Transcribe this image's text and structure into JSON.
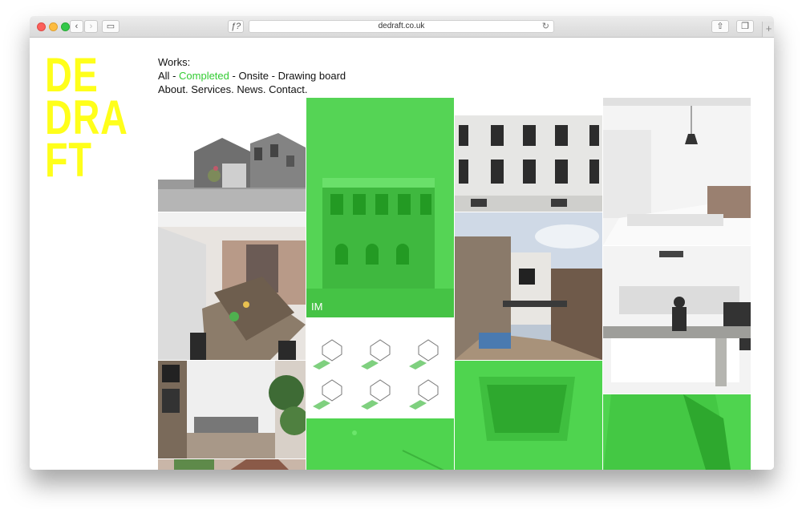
{
  "browser": {
    "url": "dedraft.co.uk",
    "reader_icon": "ƒ?",
    "icons": [
      "back-icon",
      "forward-icon",
      "sidebar-icon",
      "reload-icon",
      "share-icon",
      "tabs-icon",
      "new-tab-icon"
    ]
  },
  "logo": {
    "lines": [
      "DE",
      "DRA",
      "FT"
    ],
    "color": "#ffff1a"
  },
  "nav": {
    "heading": "Works:",
    "filters": {
      "all": "All",
      "completed": "Completed",
      "onsite": "Onsite",
      "drawing": "Drawing board",
      "sep": " - "
    },
    "pages": {
      "about": "About.",
      "services": "Services.",
      "news": "News.",
      "contact": "Contact."
    }
  },
  "tiles": {
    "im_label": "IM"
  },
  "colors": {
    "accent": "#33cc33",
    "overlay": "#4fd44f"
  }
}
